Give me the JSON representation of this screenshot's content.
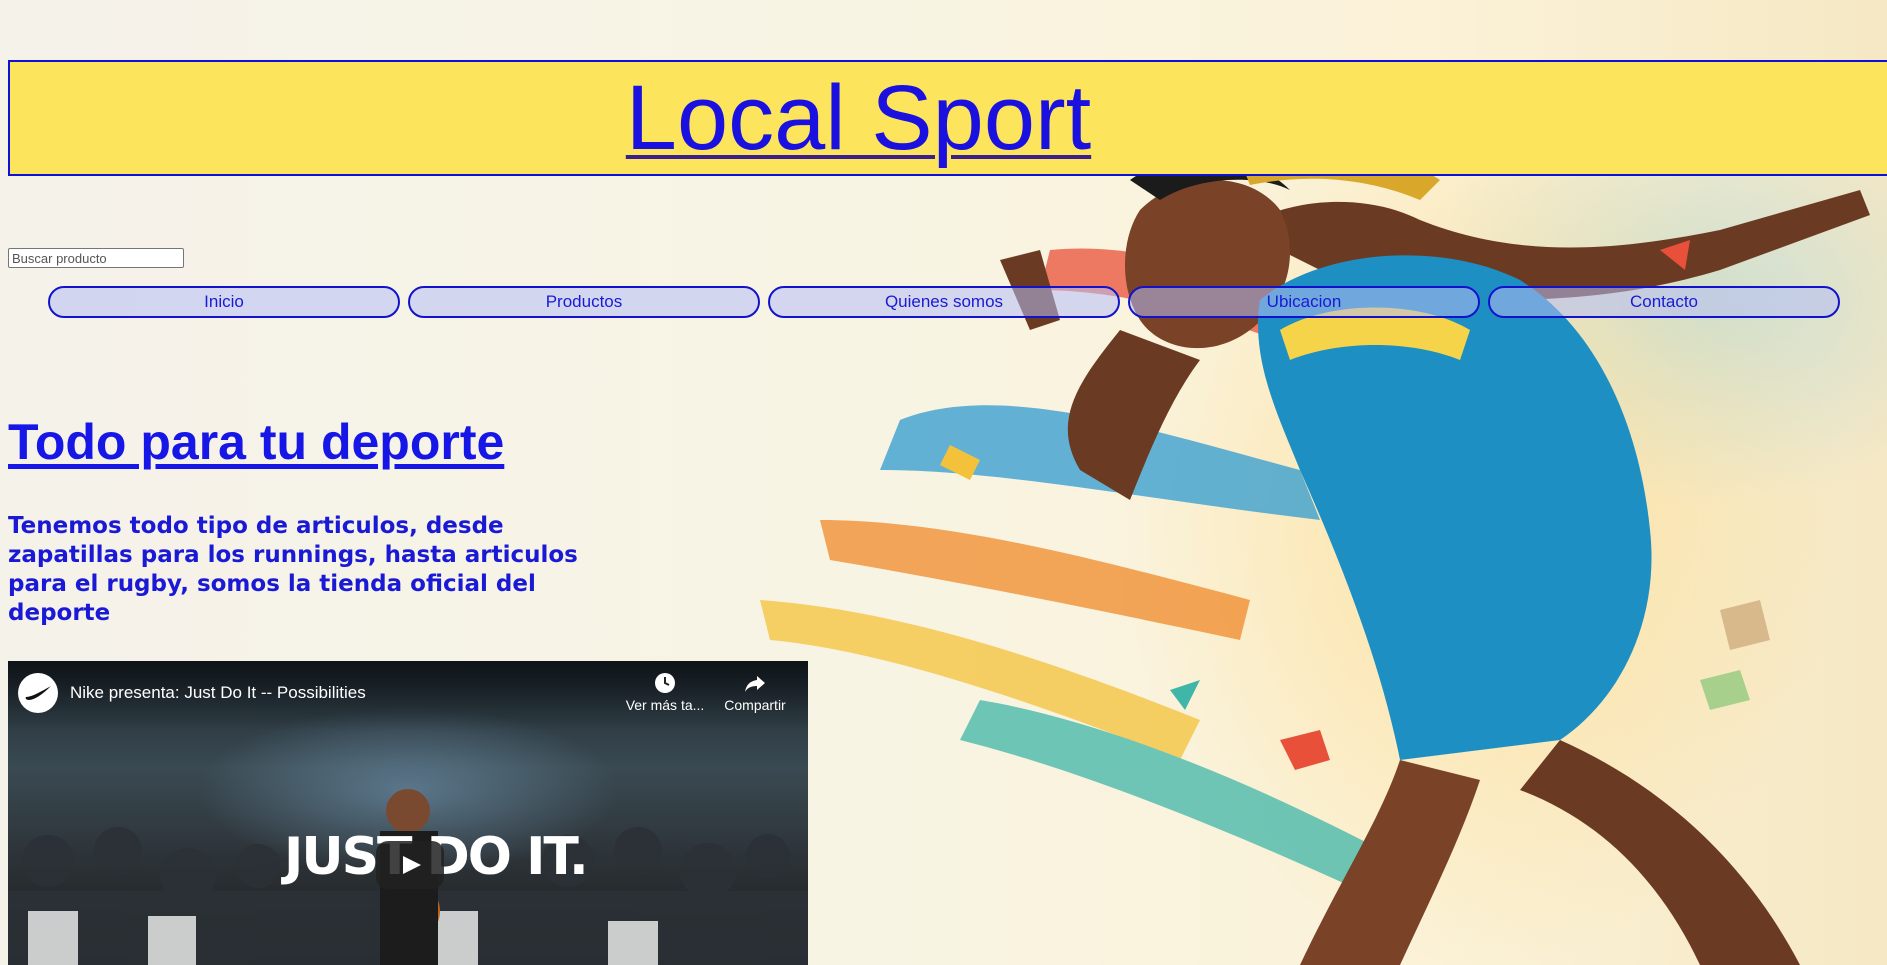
{
  "header": {
    "site_title": "Local Sport"
  },
  "search": {
    "placeholder": "Buscar producto"
  },
  "nav": {
    "items": [
      {
        "label": "Inicio"
      },
      {
        "label": "Productos"
      },
      {
        "label": "Quienes somos"
      },
      {
        "label": "Ubicacion"
      },
      {
        "label": "Contacto"
      }
    ]
  },
  "main": {
    "title": "Todo para tu deporte",
    "description": "Tenemos todo tipo de articulos, desde zapatillas para los runnings, hasta articulos para el rugby, somos la tienda oficial del deporte"
  },
  "video": {
    "title": "Nike presenta: Just Do It -- Possibilities",
    "watch_later_label": "Ver más ta...",
    "share_label": "Compartir",
    "overlay_text": "JUST DO IT.",
    "icons": [
      "nike-logo-icon",
      "clock-icon",
      "share-icon",
      "play-icon"
    ]
  },
  "colors": {
    "link": "#1a1ad6",
    "header_bg": "#fce45c",
    "nav_border": "#1212cc"
  }
}
